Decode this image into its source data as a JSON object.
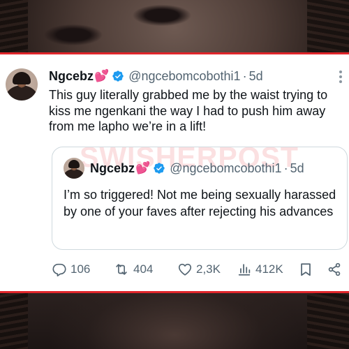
{
  "tweet": {
    "display_name": "Ngcebz",
    "name_emoji": "💕",
    "verified": true,
    "handle": "@ngcebomcobothi1",
    "separator": "·",
    "time": "5d",
    "text": "This guy literally grabbed me by the waist trying to kiss me ngenkani the way I had to push him away from me lapho we’re in a lift!"
  },
  "quoted_tweet": {
    "display_name": "Ngcebz",
    "name_emoji": "💕",
    "verified": true,
    "handle": "@ngcebomcobothi1",
    "separator": "·",
    "time": "5d",
    "text": "I’m so triggered! Not me being sexually harassed by one of your faves after rejecting his advances"
  },
  "actions": {
    "replies": "106",
    "retweets": "404",
    "likes": "2,3K",
    "views": "412K"
  },
  "watermark": "SWISHERPOST",
  "colors": {
    "frame_border": "#e0262b",
    "verified_badge": "#1d9bf0",
    "secondary_text": "#536471",
    "primary_text": "#0f1419"
  },
  "icons": [
    "verified-badge-icon",
    "more-icon",
    "reply-icon",
    "retweet-icon",
    "like-icon",
    "views-icon",
    "bookmark-icon",
    "share-icon"
  ]
}
